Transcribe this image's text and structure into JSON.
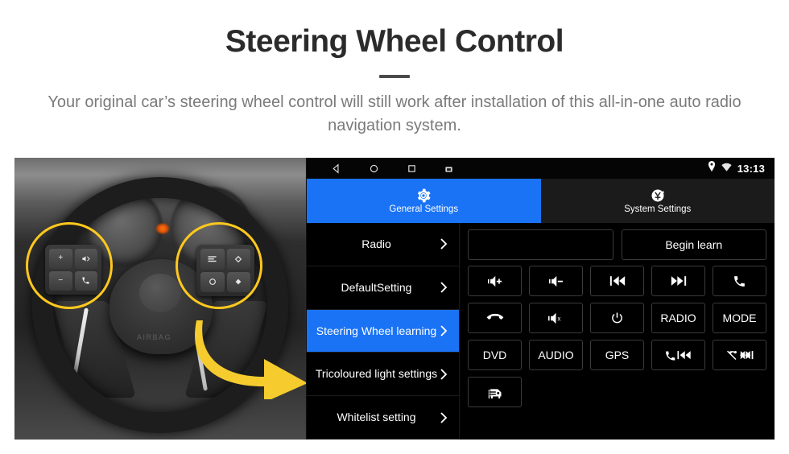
{
  "header": {
    "title": "Steering Wheel Control",
    "subtitle": "Your original car’s steering wheel control will still work after installation of this all-in-one auto radio navigation system."
  },
  "photo": {
    "alt_name": "steering-wheel-photo",
    "airbag_text": "AIRBAG",
    "highlight_color": "#ffc81e",
    "arrow_color": "#f5cb2e",
    "left_pad_keys": [
      "+",
      "−",
      "mute-voice",
      "call"
    ],
    "right_pad_keys": [
      "list",
      "up",
      "ok",
      "down"
    ]
  },
  "headunit": {
    "statusbar": {
      "back_icon": "back-triangle-icon",
      "home_icon": "home-circle-icon",
      "recents_icon": "recents-square-icon",
      "screenshot_icon": "screenshot-icon",
      "location_icon": "location-pin-icon",
      "wifi_icon": "wifi-icon",
      "time": "13:13"
    },
    "tabs": [
      {
        "label": "General Settings",
        "icon": "gear-icon",
        "active": true,
        "accent": "#1a73f5"
      },
      {
        "label": "System Settings",
        "icon": "system-swirl-icon",
        "active": false,
        "accent": "#1b1b1b"
      }
    ],
    "sidebar": [
      {
        "label": "Radio",
        "selected": false
      },
      {
        "label": "DefaultSetting",
        "selected": false
      },
      {
        "label": "Steering Wheel learning",
        "selected": true
      },
      {
        "label": "Tricoloured light settings",
        "selected": false
      },
      {
        "label": "Whitelist setting",
        "selected": false
      }
    ],
    "panel": {
      "learn_field_value": "",
      "learn_field_placeholder": "",
      "begin_learn_label": "Begin learn",
      "buttons": [
        {
          "label": "",
          "icon": "volume-up-icon",
          "name": "volume-up-button"
        },
        {
          "label": "",
          "icon": "volume-down-icon",
          "name": "volume-down-button"
        },
        {
          "label": "",
          "icon": "previous-track-icon",
          "name": "previous-track-button"
        },
        {
          "label": "",
          "icon": "next-track-icon",
          "name": "next-track-button"
        },
        {
          "label": "",
          "icon": "phone-answer-icon",
          "name": "answer-call-button"
        },
        {
          "label": "",
          "icon": "phone-hangup-icon",
          "name": "hangup-call-button"
        },
        {
          "label": "",
          "icon": "volume-mute-icon",
          "name": "mute-button"
        },
        {
          "label": "",
          "icon": "power-icon",
          "name": "power-button"
        },
        {
          "label": "RADIO",
          "icon": "",
          "name": "radio-button"
        },
        {
          "label": "MODE",
          "icon": "",
          "name": "mode-button"
        },
        {
          "label": "DVD",
          "icon": "",
          "name": "dvd-button"
        },
        {
          "label": "AUDIO",
          "icon": "",
          "name": "audio-button"
        },
        {
          "label": "GPS",
          "icon": "",
          "name": "gps-button"
        },
        {
          "label": "",
          "icon": "answer-previous-icon",
          "name": "answer-previous-button"
        },
        {
          "label": "",
          "icon": "reject-next-icon",
          "name": "reject-next-button"
        },
        {
          "label": "",
          "icon": "car-icon",
          "name": "car-settings-button"
        }
      ]
    }
  }
}
